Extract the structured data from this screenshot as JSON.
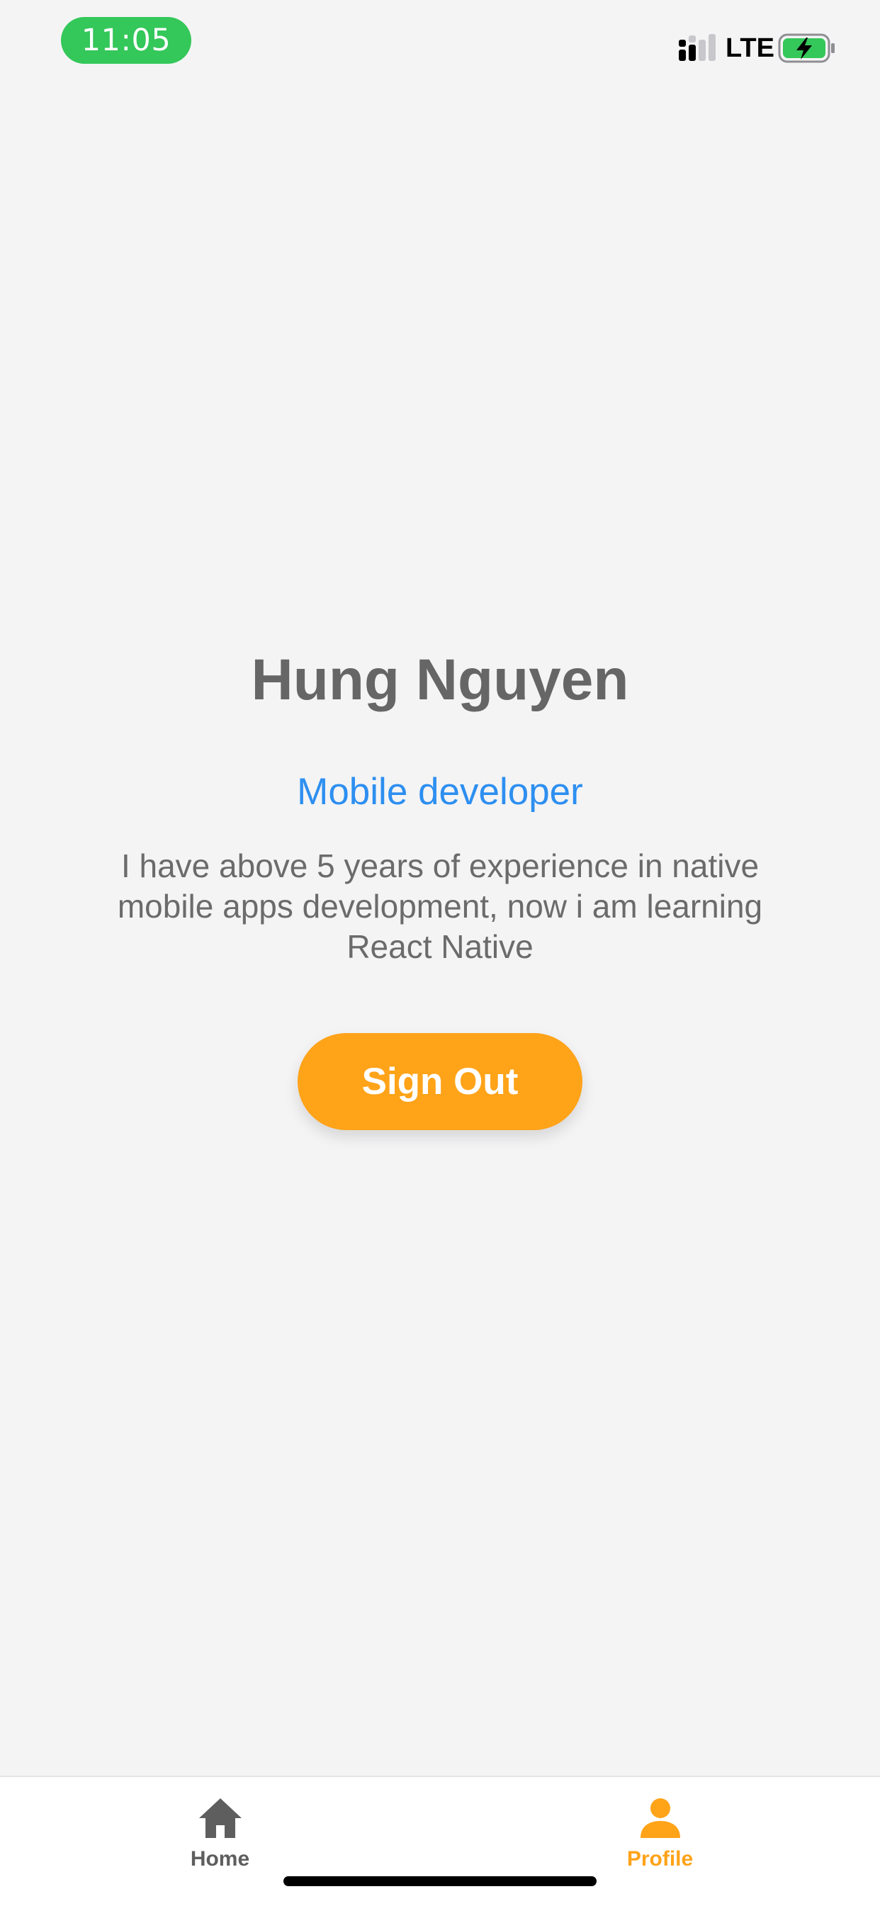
{
  "status_bar": {
    "time": "11:05",
    "network": "LTE",
    "signal_icon": "signal-icon",
    "battery_icon": "battery-charging-icon",
    "time_pill_color": "#34c759",
    "battery_color": "#34c759"
  },
  "profile": {
    "name": "Hung Nguyen",
    "role": "Mobile developer",
    "bio": "I have above 5 years of experience in native mobile apps development, now i am learning React Native"
  },
  "actions": {
    "sign_out_label": "Sign Out"
  },
  "tab_bar": {
    "items": [
      {
        "label": "Home",
        "icon": "home-icon",
        "active": false
      },
      {
        "label": "Profile",
        "icon": "person-icon",
        "active": true
      }
    ]
  },
  "colors": {
    "accent": "#ffa319",
    "role_text": "#2d8ff0",
    "background": "#f4f4f5",
    "inactive_tab": "#5e5e5e"
  }
}
